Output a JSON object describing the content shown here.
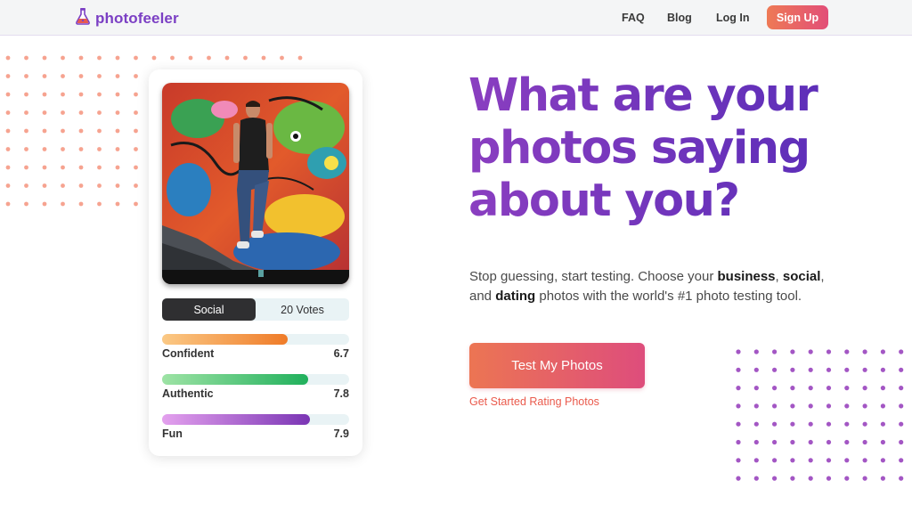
{
  "header": {
    "logo_text": "photofeeler",
    "nav": {
      "faq": "FAQ",
      "blog": "Blog",
      "login": "Log In",
      "signup": "Sign Up"
    }
  },
  "card": {
    "tabs": {
      "active": "Social",
      "votes": "20 Votes"
    },
    "metrics": [
      {
        "label": "Confident",
        "value": "6.7",
        "fill_fraction": 0.67,
        "color_from": "#fbc985",
        "color_to": "#ef7b28"
      },
      {
        "label": "Authentic",
        "value": "7.8",
        "fill_fraction": 0.78,
        "color_from": "#9ee3a5",
        "color_to": "#20b05c"
      },
      {
        "label": "Fun",
        "value": "7.9",
        "fill_fraction": 0.79,
        "color_from": "#e4a1ee",
        "color_to": "#7a35b4"
      }
    ]
  },
  "hero": {
    "headline": [
      "What are your",
      "photos saying",
      "about you?"
    ],
    "sub_parts": {
      "p1": "Stop guessing, start testing. Choose your ",
      "business": "business",
      "p2": ", ",
      "social": "social",
      "p3": ",",
      "p4": "and ",
      "dating": "dating",
      "p5": " photos with the world's #1 photo testing tool."
    },
    "cta": "Test My Photos",
    "cta_secondary": "Get Started Rating Photos"
  },
  "colors": {
    "brand_purple": "#7b3fc4",
    "accent_orange": "#ec7553",
    "accent_pink": "#de4d7c",
    "dot_salmon": "#f6a390",
    "dot_purple": "#a356c4"
  }
}
